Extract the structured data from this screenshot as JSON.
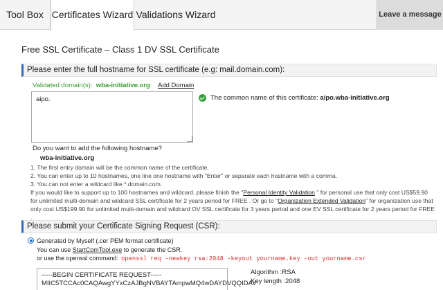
{
  "tabs": {
    "toolbox": "Tool Box",
    "certificates": "Certificates Wizard",
    "validations": "Validations Wizard",
    "leave_message": "Leave a message"
  },
  "page_title": "Free SSL Certificate – Class 1 DV SSL Certificate",
  "hostname_section": {
    "heading": "Please enter the full hostname for SSL certificate (e.g: mail.domain.com):",
    "validated_label": "Validated domain(s):",
    "validated_domain": "wba-initiative.org",
    "add_domain": "Add Domain",
    "hostname_value": "aipo.",
    "common_name_label": "The common name of this certificate:",
    "common_name_value": "aipo.wba-initiative.org",
    "add_question": "Do you want to add the following hostname?",
    "add_hostname": "wba-initiative.org",
    "note1": "1. The first entry domain will be the common name of the certificate.",
    "note2": "2. You can enter up to 10 hostnames, one line one hostname with \"Enter\" or separate each hostname with a comma.",
    "note3": "3. You can not enter a wildcard like *.domain.com.",
    "note4_a": "If you would like to support up to 100 hostnames and wildcard, please finish the \"",
    "note4_link1": "Personal Identity Validation",
    "note4_b": " \" for personal use that only cost US$59.90 for unlimited multi-domain and wildcard SSL certificate for 2 years period for FREE . Or go to \"",
    "note4_link2": "Organization Extended Validation",
    "note4_c": "\" for organization use that only cost US$199.90 for unlimited multi-domain and wildcard OV SSL certificate for 3 years period and one EV SSL certificate for 2 years period for FREE ."
  },
  "csr_section": {
    "heading": "Please submit your Certificate Signing Request (CSR):",
    "option_generated": "Generated by Myself   (.cer PEM format certificate)",
    "use_tool_a": "You can use ",
    "use_tool_link": "StartComTool.exe",
    "use_tool_b": " to generate the CSR.",
    "openssl_label": "or use the openssl command:",
    "openssl_cmd": "openssl req -newkey rsa:2048 -keyout yourname.key -out yourname.csr",
    "csr_line1": "-----BEGIN CERTIFICATE REQUEST-----",
    "csr_line2": "MIIC5TCCAc0CAQAwgYYxCzAJBgNVBAYTAmpwMQ4wDAYDVQQIDAV",
    "algorithm": "Algorithm :RSA",
    "key_length": "Key length :2048"
  },
  "colors": {
    "accent": "#2d6fb0",
    "validated_green": "#3a9a32",
    "command_red": "#d83333"
  }
}
